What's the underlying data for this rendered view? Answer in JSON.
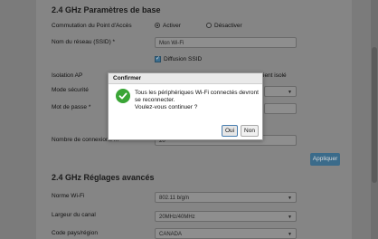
{
  "basic": {
    "title": "2.4 GHz Paramètres de base",
    "access_point_label": "Commutation du Point d'Accès",
    "activate_label": "Activer",
    "deactivate_label": "Désactiver",
    "ssid_label": "Nom du réseau (SSID) *",
    "ssid_value": "Mon Wi-Fi",
    "broadcast_label": "Diffusion SSID",
    "isolation_label": "Isolation AP",
    "isolation_option": "ient isolé",
    "security_label": "Mode sécurité",
    "password_label": "Mot de passe *",
    "connections_label": "Nombre de connexions m",
    "connections_value": "20",
    "apply_label": "Appliquer"
  },
  "advanced": {
    "title": "2.4 GHz Réglages avancés",
    "mode_label": "Norme Wi-Fi",
    "mode_value": "802.11 b/g/n",
    "bandwidth_label": "Largeur du canal",
    "bandwidth_value": "20MHz/40MHz",
    "country_label": "Code pays/région",
    "country_value": "CANADA"
  },
  "dialog": {
    "title": "Confirmer",
    "message_line1": "Tous les périphériques Wi-Fi connectés devront",
    "message_line2": "se reconnecter.",
    "message_line3": "Voulez-vous continuer ?",
    "yes_label": "Oui",
    "no_label": "Non"
  }
}
